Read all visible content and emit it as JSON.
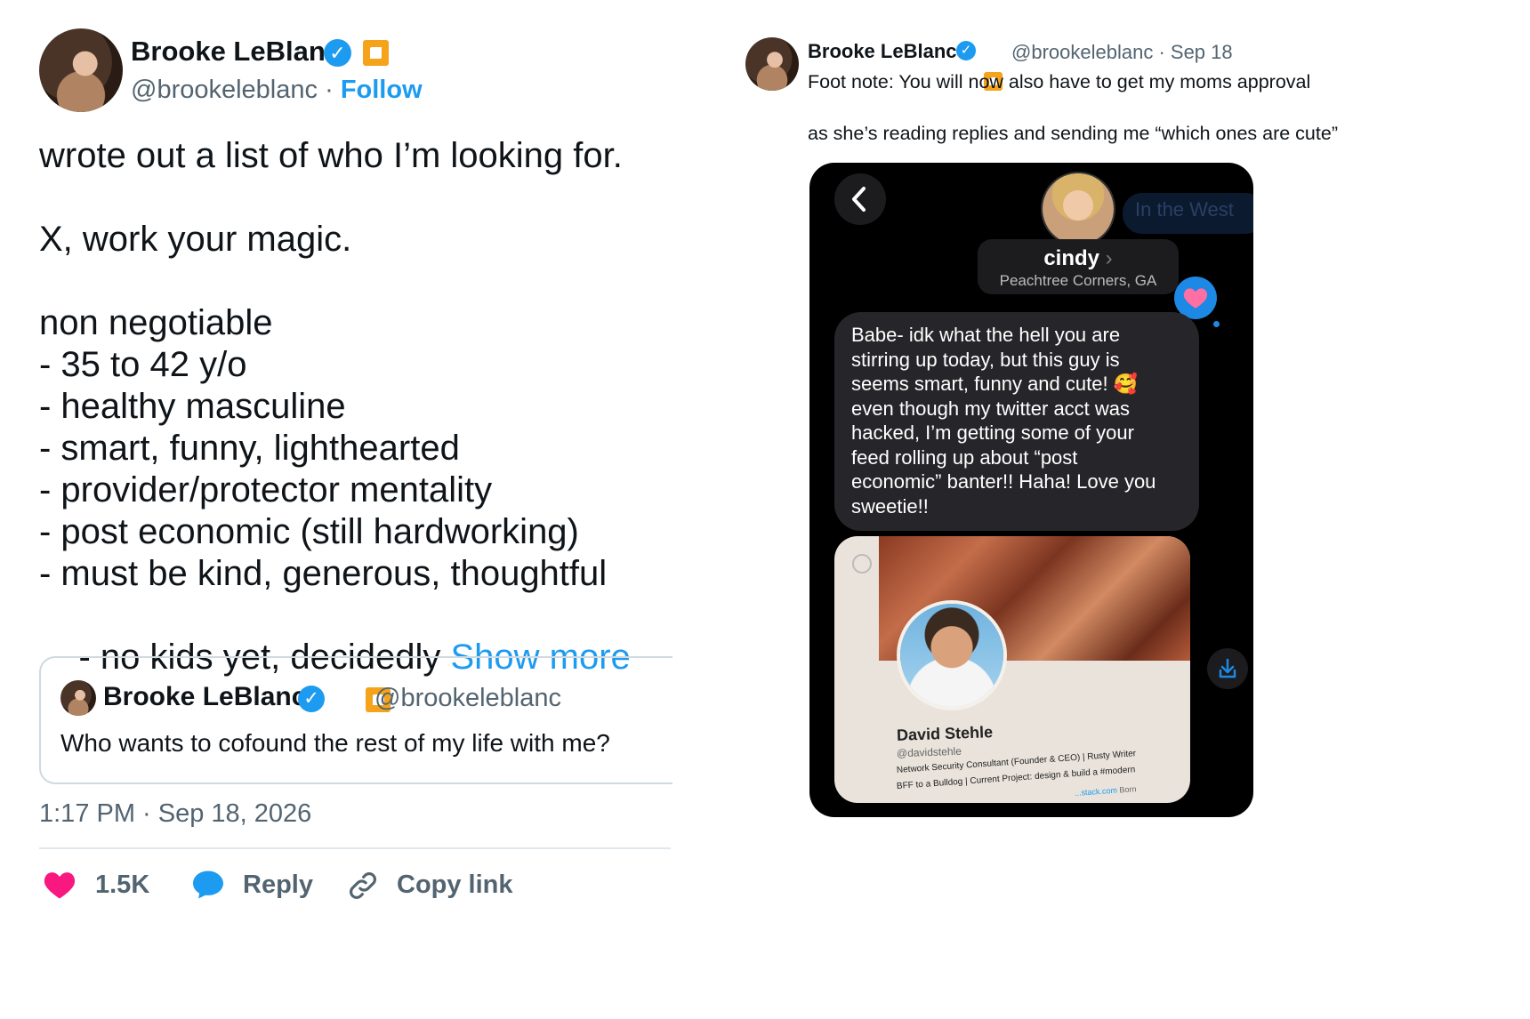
{
  "left_tweet": {
    "author_name": "Brooke LeBlanc",
    "handle": "@brookeleblanc",
    "separator": "·",
    "follow_label": "Follow",
    "lines": [
      "wrote out a list of who I’m looking for.",
      "X, work your magic.",
      "non negotiable",
      "- 35 to 42 y/o",
      "- healthy masculine",
      "- smart, funny, lighthearted",
      "- provider/protector mentality",
      "- post economic (still hardworking)",
      "- must be kind, generous, thoughtful",
      "- no kids yet, decidedly "
    ],
    "show_more": "Show more",
    "quote": {
      "author_name": "Brooke LeBlanc",
      "handle": "@brookeleblanc",
      "text": "Who wants to cofound the rest of my life with me?"
    },
    "timestamp": "1:17 PM · Sep 18, 2026",
    "actions": {
      "like_count": "1.5K",
      "reply_label": "Reply",
      "copy_label": "Copy link"
    },
    "colors": {
      "like": "#f91880",
      "reply": "#1d9bf0",
      "link": "#1d9bf0"
    }
  },
  "right_tweet": {
    "author_name": "Brooke LeBlanc",
    "handle": "@brookeleblanc",
    "date": "· Sep 18",
    "line1": "Foot note: You will now also have to get my moms approval",
    "line2": "as she’s reading replies and sending me “which ones are cute”",
    "screenshot": {
      "contact_name": "cindy",
      "contact_location": "Peachtree Corners, GA",
      "faded_text": "In the West",
      "message_lines": [
        "Babe- idk what the hell you are",
        "stirring up today, but this guy is",
        "seems smart, funny and cute! 🥰",
        "even though my twitter acct  was",
        "hacked, I’m getting some of your",
        "feed rolling up about “post",
        "economic” banter!! Haha! Love you",
        "sweetie!!"
      ],
      "card_name": "David Stehle",
      "card_handle": "@davidstehle",
      "card_bio_1": "Network Security Consultant (Founder & CEO) | Rusty Writer",
      "card_bio_2": "BFF to a Bulldog | Current Project: design & build a #modern",
      "card_link": "...stack.com",
      "card_born": "Born"
    }
  }
}
